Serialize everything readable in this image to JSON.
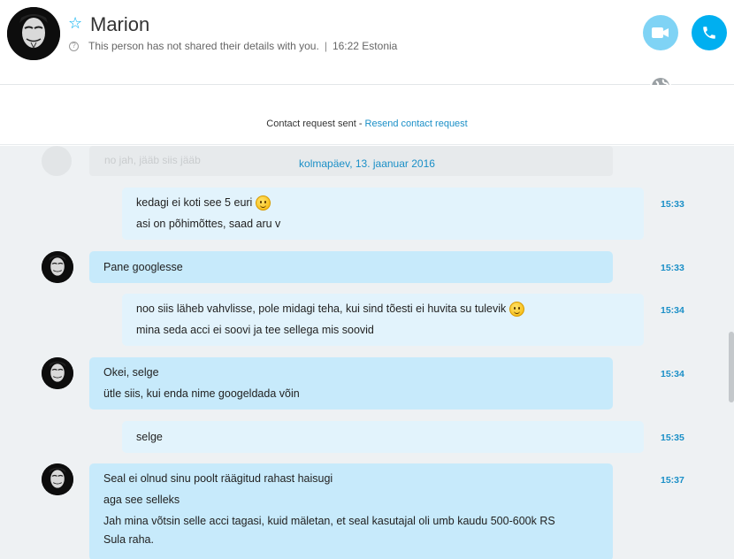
{
  "header": {
    "contact_name": "Marion",
    "status_text": "This person has not shared their details with you.",
    "time_location": "16:22 Estonia"
  },
  "contact_request": {
    "text": "Contact request sent - ",
    "link_label": "Resend contact request"
  },
  "chat": {
    "ghost_message": "no jah, jääb siis jääb",
    "date_separator": "kolmapäev, 13. jaanuar 2016",
    "messages": [
      {
        "direction": "out",
        "lines": [
          "kedagi ei koti see 5 euri",
          "asi on põhimõttes, saad aru v"
        ],
        "time": "15:33"
      },
      {
        "direction": "in",
        "lines": [
          "Pane googlesse"
        ],
        "time": "15:33"
      },
      {
        "direction": "out",
        "lines": [
          "noo siis läheb vahvlisse, pole midagi teha, kui sind tõesti ei huvita su tulevik",
          "mina seda acci ei soovi ja tee sellega mis soovid"
        ],
        "time": "15:34"
      },
      {
        "direction": "in",
        "lines": [
          "Okei, selge",
          "ütle siis, kui enda nime googeldada võin"
        ],
        "time": "15:34"
      },
      {
        "direction": "out",
        "lines": [
          "selge"
        ],
        "time": "15:35"
      },
      {
        "direction": "in",
        "lines": [
          "Seal ei olnud sinu poolt räägitud rahast haisugi",
          "aga see selleks",
          "Jah mina võtsin selle acci tagasi, kuid mäletan, et seal kasutajal oli umb kaudu 500-600k RS",
          "Sula raha."
        ],
        "time": "15:37"
      }
    ]
  },
  "colors": {
    "accent": "#00aff0",
    "incoming_bubble": "#c7eafb",
    "outgoing_bubble": "#e2f3fc",
    "link": "#1a8fc7"
  },
  "icons": [
    "star-icon",
    "question-icon",
    "video-call-icon",
    "phone-call-icon",
    "globe-icon",
    "smiley-icon"
  ]
}
